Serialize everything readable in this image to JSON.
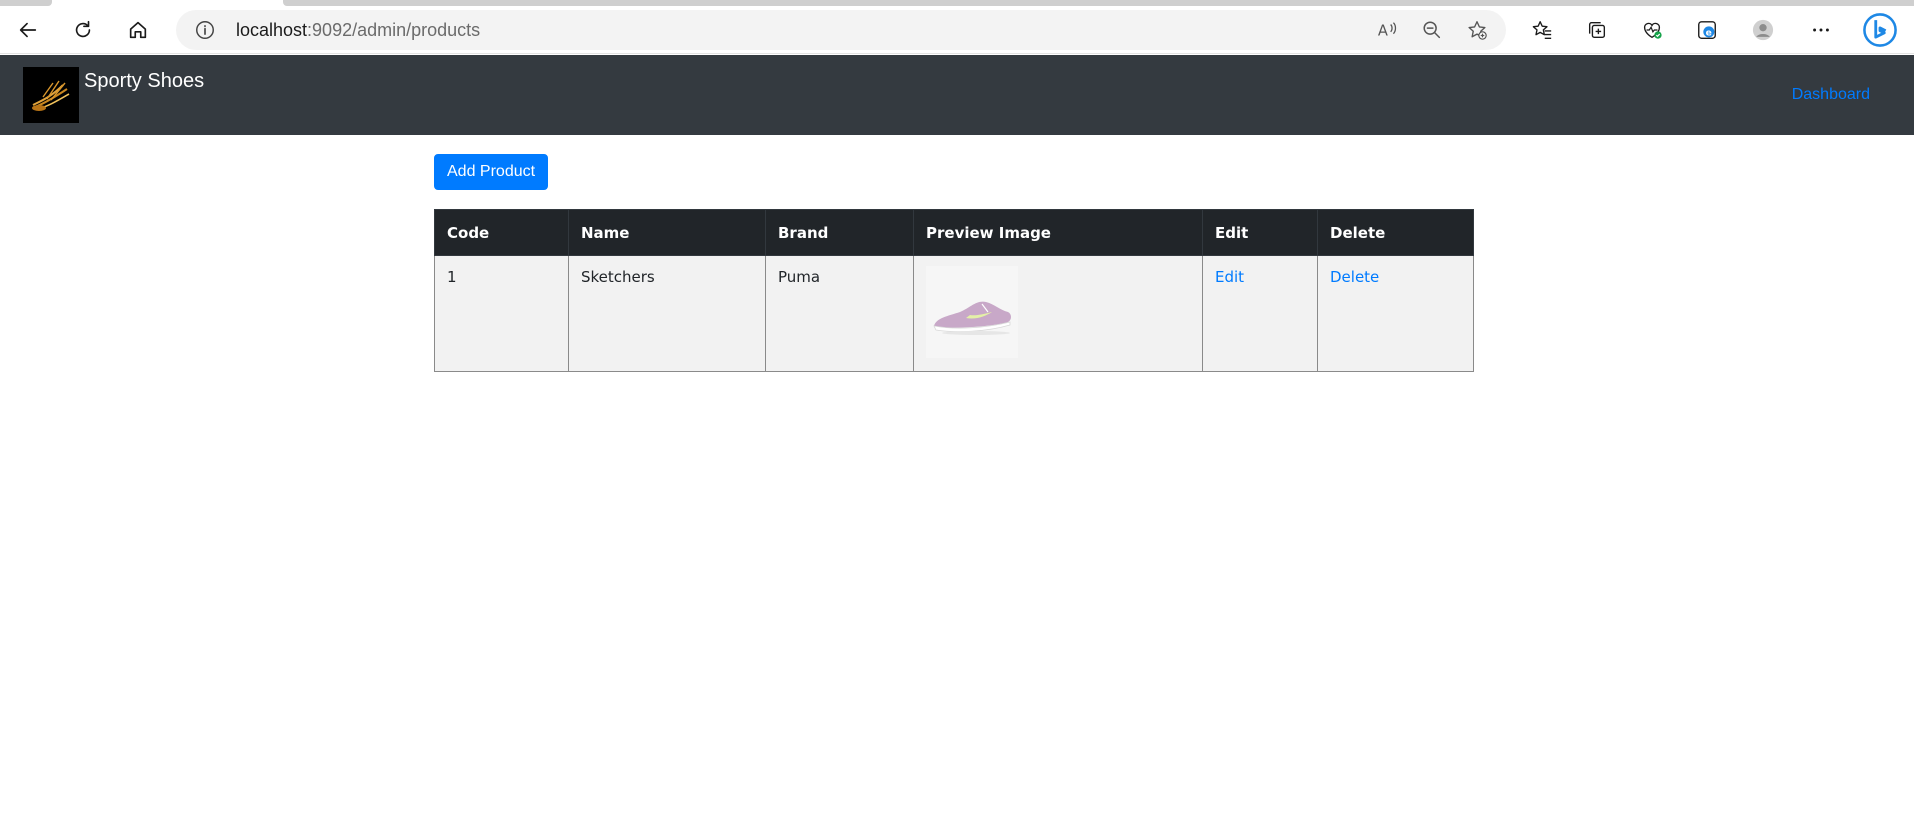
{
  "browser": {
    "url_host": "localhost",
    "url_rest": ":9092/admin/products"
  },
  "navbar": {
    "brand": "Sporty Shoes",
    "dashboard_link": "Dashboard"
  },
  "actions": {
    "add_product": "Add Product"
  },
  "table": {
    "headers": [
      "Code",
      "Name",
      "Brand",
      "Preview Image",
      "Edit",
      "Delete"
    ],
    "rows": [
      {
        "code": "1",
        "name": "Sketchers",
        "brand": "Puma",
        "edit": "Edit",
        "delete": "Delete"
      }
    ]
  },
  "colors": {
    "navbar_bg": "#343a40",
    "primary": "#007bff",
    "table_header_bg": "#212529"
  }
}
